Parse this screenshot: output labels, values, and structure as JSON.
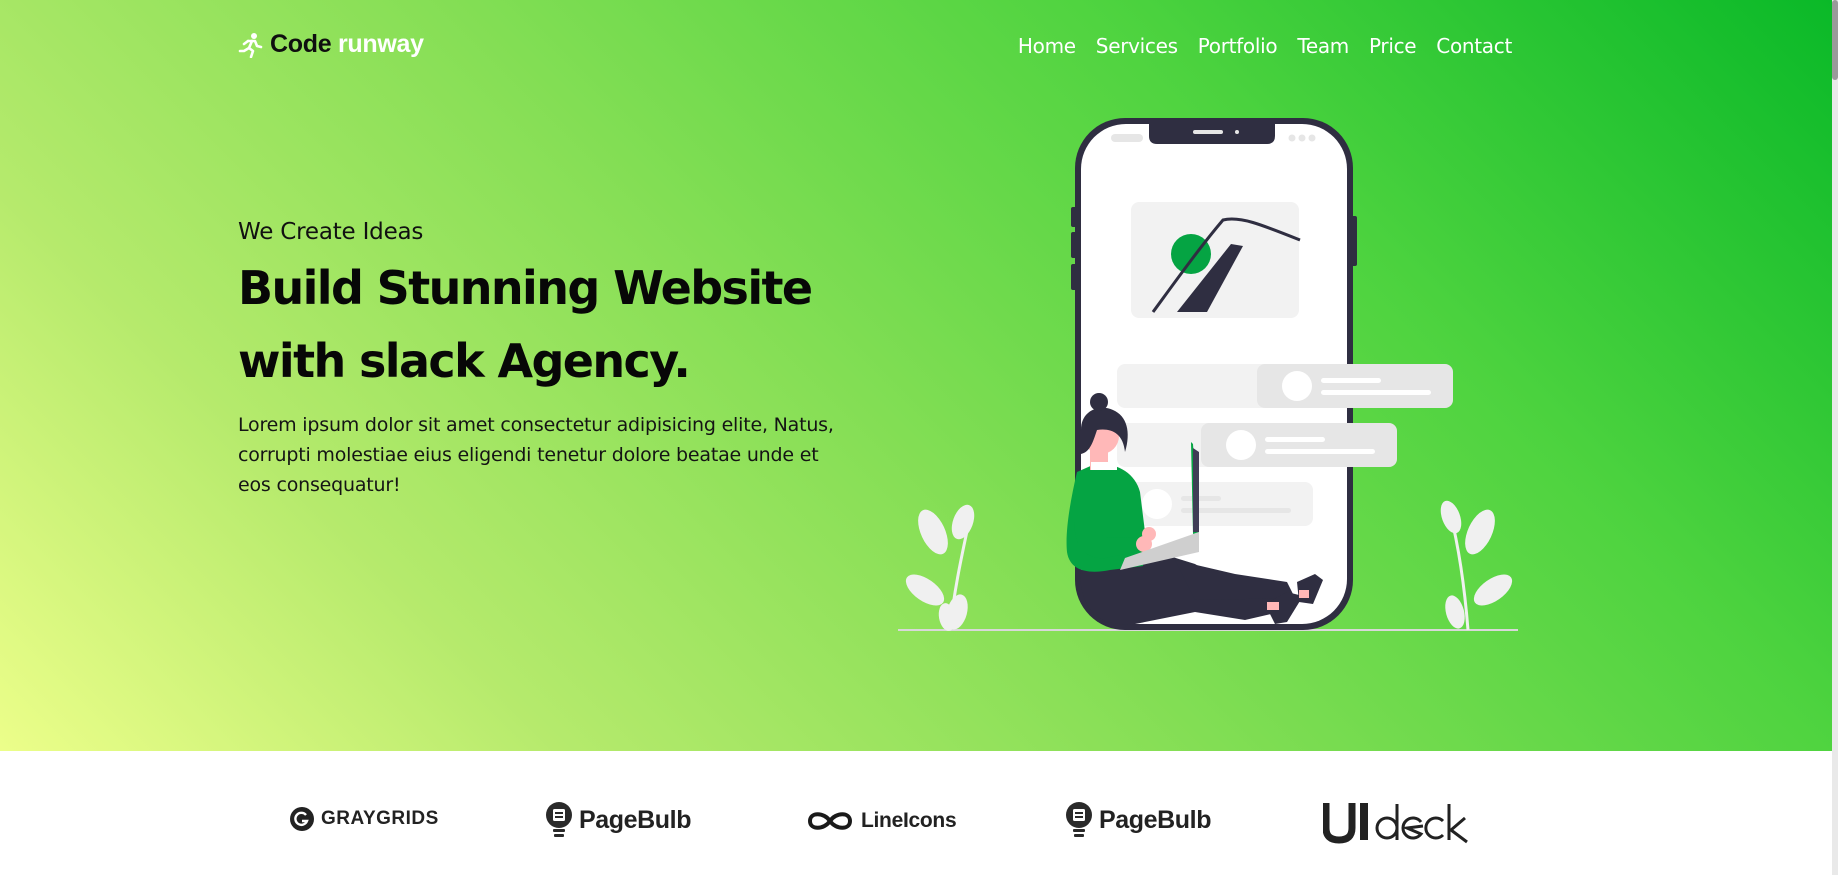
{
  "header": {
    "logo": {
      "word1": "Code",
      "word2": "runway",
      "icon": "runner-icon"
    },
    "nav": [
      "Home",
      "Services",
      "Portfolio",
      "Team",
      "Price",
      "Contact"
    ]
  },
  "hero": {
    "eyebrow": "We Create Ideas",
    "headline_line1": "Build Stunning Website",
    "headline_line2": "with slack Agency.",
    "description": "Lorem ipsum dolor sit amet consectetur adipisicing elite, Natus, corrupti molestiae eius eligendi tenetur dolore beatae unde et eos consequatur!",
    "illustration": "woman-with-laptop-and-phone-illustration"
  },
  "brands": [
    {
      "name": "GRAYGRIDS",
      "icon": "graygrids-logo"
    },
    {
      "name": "PageBulb",
      "icon": "bulb-logo"
    },
    {
      "name": "LineIcons",
      "icon": "infinity-logo"
    },
    {
      "name": "PageBulb",
      "icon": "bulb-logo"
    },
    {
      "name": "UIdeck",
      "icon": "uideck-logo"
    }
  ],
  "colors": {
    "gradient_start": "#0ab928",
    "gradient_end": "#ecfe8a",
    "accent_green": "#05a443",
    "dark": "#2f2e41"
  }
}
